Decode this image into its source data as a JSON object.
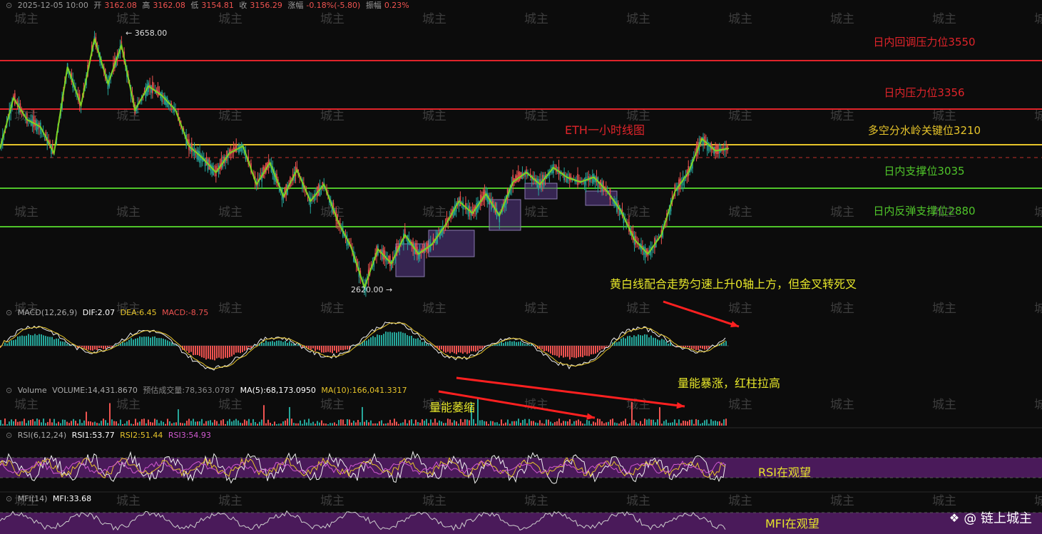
{
  "header": {
    "date": "2025-12-05 10:00",
    "open_label": "开",
    "open": "3162.08",
    "high_label": "高",
    "high": "3162.08",
    "low_label": "低",
    "low": "3154.81",
    "close_label": "收",
    "close": "3156.29",
    "change_label": "涨幅",
    "change": "-0.18%(-5.80)",
    "amplitude_label": "振幅",
    "amplitude": "0.23%"
  },
  "chart_title": "ETH一小时线图",
  "levels": [
    {
      "label": "日内回调压力位3550",
      "value": 3550,
      "color": "#e0242a"
    },
    {
      "label": "日内压力位3356",
      "value": 3356,
      "color": "#e0242a"
    },
    {
      "label": "多空分水岭关键位3210",
      "value": 3210,
      "color": "#e6c42a"
    },
    {
      "label": "日内支撑位3035",
      "value": 3035,
      "color": "#4fc42a"
    },
    {
      "label": "日内反弹支撑位2880",
      "value": 2880,
      "color": "#4fc42a"
    }
  ],
  "price_marks": {
    "high": "← 3658.00",
    "low": "2620.00 →"
  },
  "annotations": {
    "macd_note": "黄白线配合走势匀速上升0轴上方，但金叉转死叉",
    "volume_up_note": "量能暴涨，红柱拉高",
    "volume_down_note": "量能萎缩",
    "rsi_note": "RSI在观望",
    "mfi_note": "MFI在观望"
  },
  "macd": {
    "name": "MACD(12,26,9)",
    "dif": "DIF:2.07",
    "dea": "DEA:6.45",
    "macd": "MACD:-8.75"
  },
  "volume": {
    "name": "Volume",
    "volume": "VOLUME:14,431.8670",
    "est": "预估成交量:78,363.0787",
    "ma5": "MA(5):68,173.0950",
    "ma10": "MA(10):166,041.3317"
  },
  "rsi": {
    "name": "RSI(6,12,24)",
    "rsi1": "RSI1:53.77",
    "rsi2": "RSI2:51.44",
    "rsi3": "RSI3:54.93"
  },
  "mfi": {
    "name": "MFI(14)",
    "mfi": "MFI:33.68"
  },
  "watermark": "城主",
  "brand": "@ 链上城主",
  "colors": {
    "up": "#26a69a",
    "down": "#ef5350",
    "bg": "#0c0c0c",
    "zone": "#4a1a5a",
    "trend": "#7ed321",
    "box": "#5a3a8a"
  },
  "chart_data": {
    "type": "line",
    "title": "ETH一小时线图",
    "y_range": [
      2600,
      3700
    ],
    "price_path": [
      3200,
      3410,
      3320,
      3290,
      3180,
      3540,
      3380,
      3658,
      3470,
      3630,
      3360,
      3460,
      3420,
      3360,
      3210,
      3160,
      3100,
      3180,
      3210,
      3050,
      3140,
      3000,
      3110,
      2980,
      3050,
      2900,
      2790,
      2620,
      2780,
      2720,
      2840,
      2760,
      2800,
      2880,
      2980,
      2930,
      3010,
      2920,
      3060,
      3100,
      3050,
      3120,
      3080,
      3060,
      3080,
      3020,
      2940,
      2820,
      2760,
      2840,
      3020,
      3100,
      3240,
      3190,
      3200
    ],
    "levels": [
      3550,
      3356,
      3210,
      3035,
      2880
    ],
    "high": 3658.0,
    "low": 2620.0
  }
}
